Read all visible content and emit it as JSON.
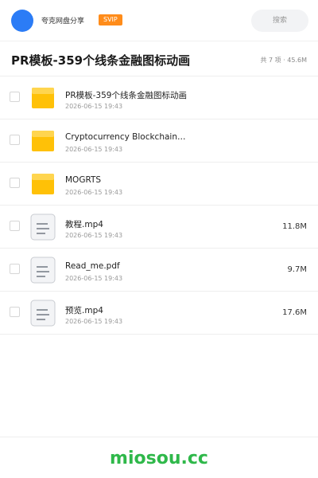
{
  "header": {
    "app_name": "夸克网盘分享",
    "badge": "SVIP",
    "search_placeholder": "搜索",
    "avatar_color": "#2b7cf6",
    "badge_color": "#ff8c1a"
  },
  "folder": {
    "title": "PR模板-359个线条金融图标动画",
    "summary": "共 7 项 · 45.6M"
  },
  "files": [
    {
      "name": "PR模板-359个线条金融图标动画",
      "date": "2026-06-15 19:43",
      "size": "",
      "icon": "folder-icon"
    },
    {
      "name": "Cryptocurrency Blockchain…",
      "date": "2026-06-15 19:43",
      "size": "",
      "icon": "folder-icon"
    },
    {
      "name": "MOGRTS",
      "date": "2026-06-15 19:43",
      "size": "",
      "icon": "folder-icon"
    },
    {
      "name": "教程.mp4",
      "date": "2026-06-15 19:43",
      "size": "11.8M",
      "icon": "file-icon"
    },
    {
      "name": "Read_me.pdf",
      "date": "2026-06-15 19:43",
      "size": "9.7M",
      "icon": "file-icon"
    },
    {
      "name": "预览.mp4",
      "date": "2026-06-15 19:43",
      "size": "17.6M",
      "icon": "file-icon"
    }
  ],
  "footer": {
    "brand": "miosou.cc",
    "brand_color": "#2fb84a"
  }
}
